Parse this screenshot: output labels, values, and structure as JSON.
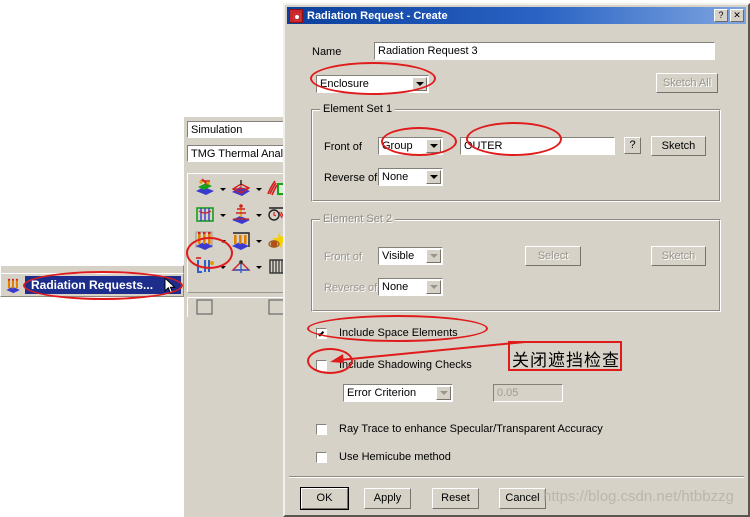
{
  "dialog": {
    "title": "Radiation Request - Create",
    "app_icon": "radiation-icon",
    "help_button": "?",
    "close_button": "✕",
    "name_label": "Name",
    "name_value": "Radiation Request 3",
    "type_combo_value": "Enclosure",
    "sketch_all_button": "Sketch All",
    "element_set_1": {
      "title": "Element Set 1",
      "front_of_label": "Front of",
      "front_of_value": "Group",
      "front_of_text_value": "OUTER",
      "query_button": "?",
      "sketch_button": "Sketch",
      "reverse_of_label": "Reverse of",
      "reverse_of_value": "None"
    },
    "element_set_2": {
      "title": "Element Set 2",
      "front_of_label": "Front of",
      "front_of_value": "Visible",
      "select_button": "Select",
      "sketch_button": "Sketch",
      "reverse_of_label": "Reverse of",
      "reverse_of_value": "None"
    },
    "checkboxes": {
      "include_space_elements": "Include Space Elements",
      "include_space_elements_checked": true,
      "include_shadowing_checks": "Include Shadowing Checks",
      "include_shadowing_checks_checked": false,
      "ray_trace": "Ray Trace to enhance Specular/Transparent Accuracy",
      "ray_trace_checked": false,
      "hemicube": "Use Hemicube method",
      "hemicube_checked": false
    },
    "criterion_combo_value": "Error Criterion",
    "criterion_value": "0.05",
    "buttons": {
      "ok": "OK",
      "apply": "Apply",
      "reset": "Reset",
      "cancel": "Cancel"
    }
  },
  "left_panel": {
    "application_combo": "Simulation",
    "solution_combo": "TMG Thermal Anal",
    "menu_item": "Radiation Requests..."
  },
  "annotations": {
    "chinese_note": "关闭遮挡检查",
    "watermark": "https://blog.csdn.net/htbbzzg"
  },
  "colors": {
    "annotation_red": "#e01b1b",
    "title_blue": "#0b3f9c",
    "dialog_face": "#d6d2c8",
    "menu_highlight": "#1c2d8c"
  }
}
